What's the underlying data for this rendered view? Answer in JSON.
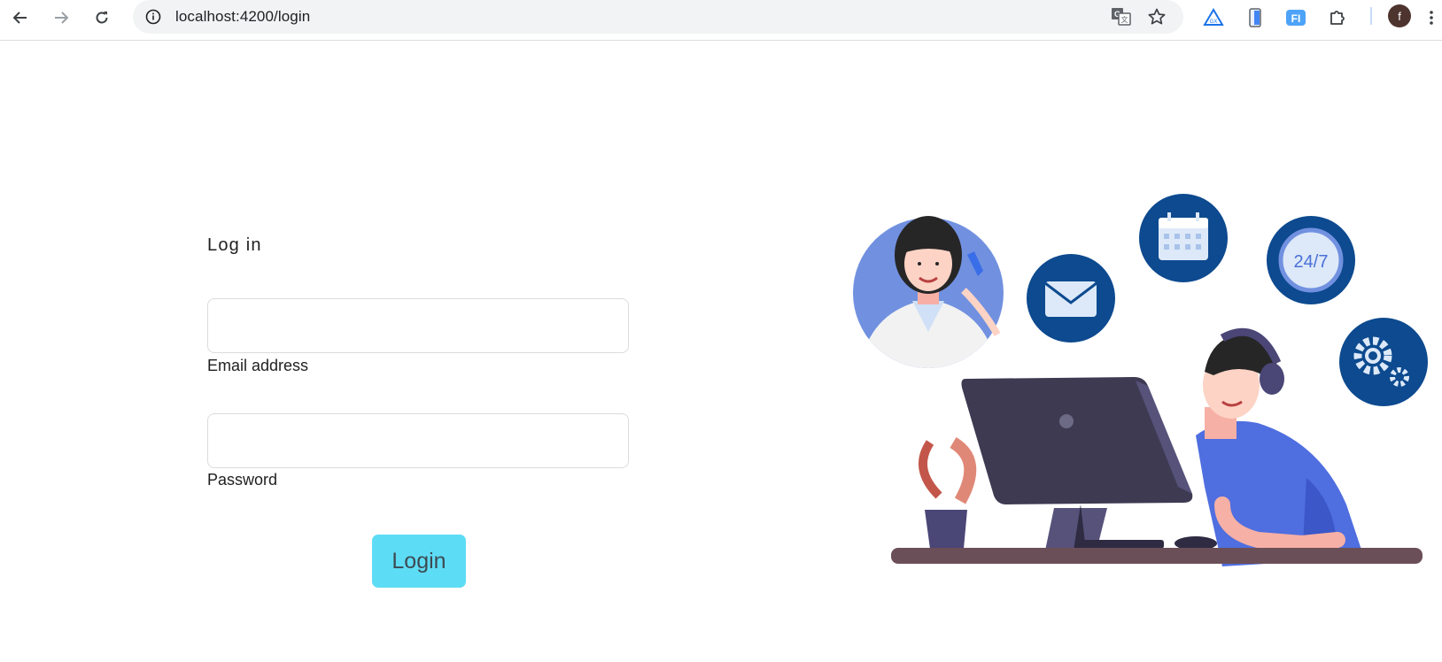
{
  "browser": {
    "url": "localhost:4200/login",
    "avatar_initial": "f",
    "back_icon": "arrow-left-icon",
    "forward_icon": "arrow-right-icon",
    "reload_icon": "reload-icon",
    "site_info_icon": "info-icon",
    "translate_icon": "translate-icon",
    "bookmark_icon": "star-icon",
    "extensions": [
      "drive-triangle-icon",
      "phone-extension-icon",
      "fi-extension-icon",
      "puzzle-icon"
    ],
    "menu_icon": "kebab-menu-icon"
  },
  "login": {
    "title": "Log in",
    "email_label": "Email address",
    "email_value": "",
    "password_label": "Password",
    "password_value": "",
    "submit_label": "Login",
    "accent_color": "#5ddcf5"
  },
  "illustration": {
    "calendar_badge_text": "24/7",
    "theme_blue": "#0d4a8f"
  }
}
